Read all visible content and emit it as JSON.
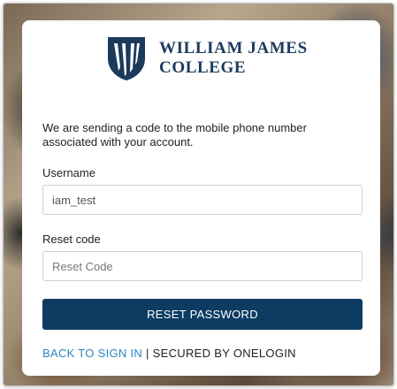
{
  "brand": {
    "line1": "William James",
    "line2": "College",
    "primary_color": "#0d3b62",
    "link_color": "#2d86b8"
  },
  "message": "We are sending a code to the mobile phone number associated with your account.",
  "form": {
    "username_label": "Username",
    "username_value": "iam_test",
    "reset_code_label": "Reset code",
    "reset_code_placeholder": "Reset Code",
    "submit_label": "RESET PASSWORD"
  },
  "footer": {
    "back_link": "BACK TO SIGN IN",
    "separator": "|",
    "secured_text": "SECURED BY ONELOGIN"
  }
}
